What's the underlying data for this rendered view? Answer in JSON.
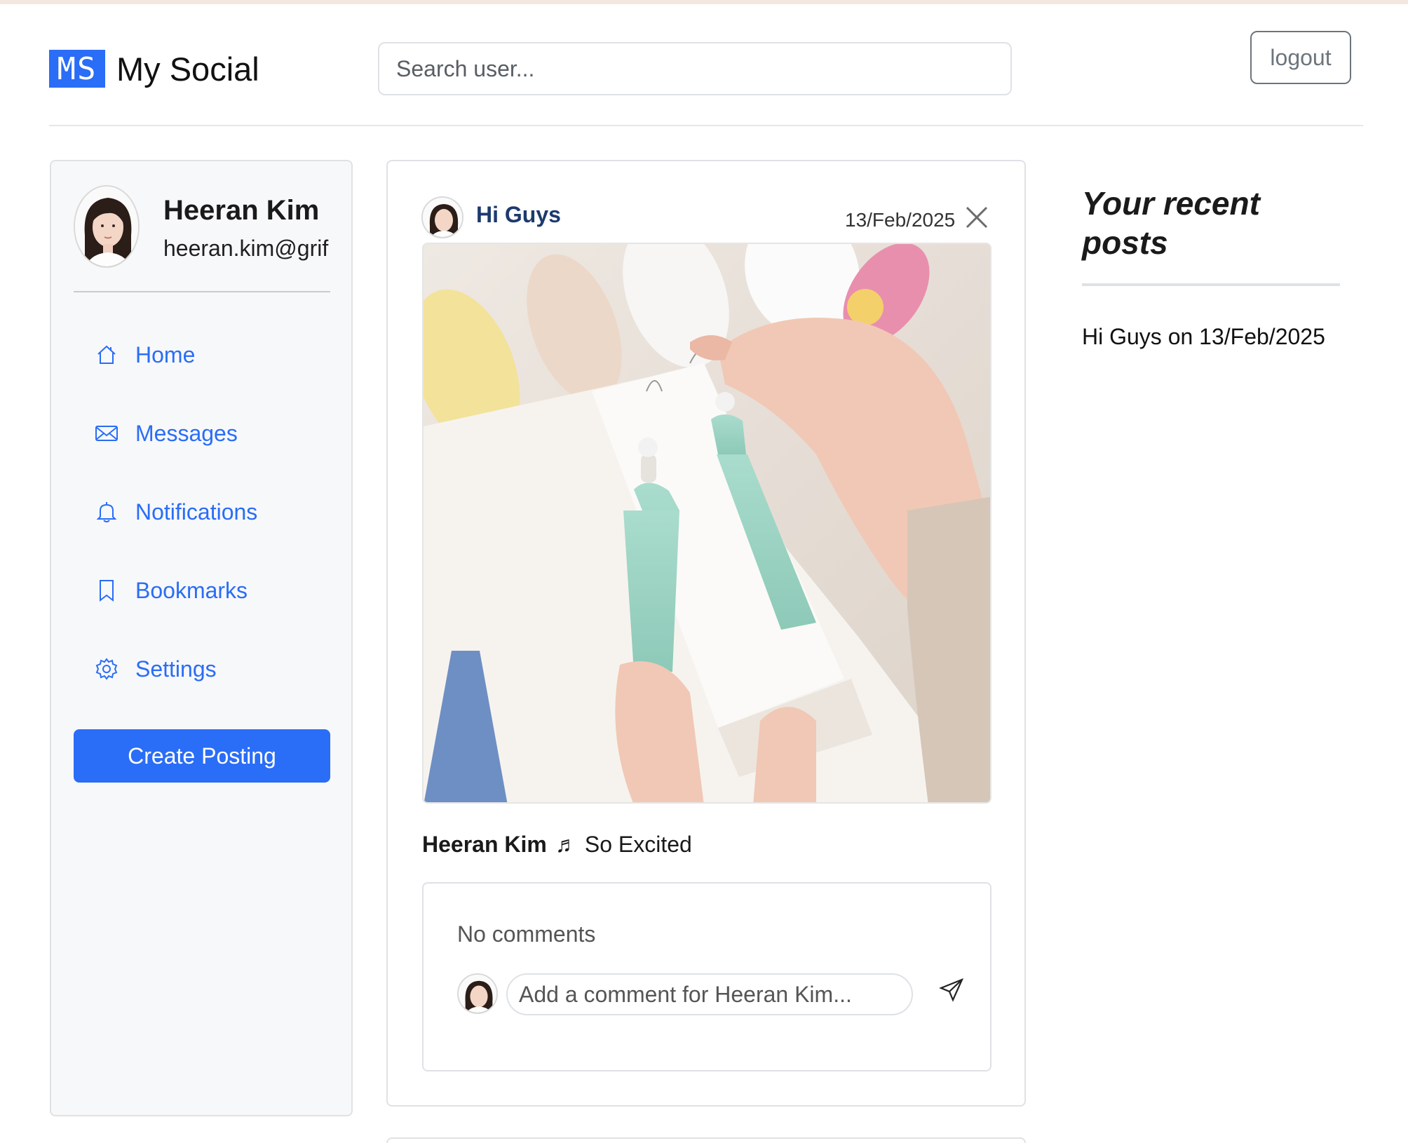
{
  "header": {
    "logo_text": "MS",
    "app_name": "My Social",
    "search_placeholder": "Search user...",
    "logout_label": "logout"
  },
  "profile": {
    "name": "Heeran Kim",
    "email": "heeran.kim@grif"
  },
  "nav": {
    "items": [
      {
        "label": "Home",
        "icon": "home-icon"
      },
      {
        "label": "Messages",
        "icon": "envelope-icon"
      },
      {
        "label": "Notifications",
        "icon": "bell-icon"
      },
      {
        "label": "Bookmarks",
        "icon": "bookmark-icon"
      },
      {
        "label": "Settings",
        "icon": "gear-icon"
      }
    ],
    "create_label": "Create Posting"
  },
  "post": {
    "title": "Hi Guys",
    "date": "13/Feb/2025",
    "author": "Heeran Kim",
    "music_icon": "music-note-icon",
    "caption": "So Excited",
    "no_comments": "No comments",
    "comment_placeholder": "Add a comment for Heeran Kim..."
  },
  "recent": {
    "title": "Your recent posts",
    "items": [
      "Hi Guys on 13/Feb/2025"
    ]
  },
  "colors": {
    "accent": "#2a6df6",
    "post_title": "#1c3a6e",
    "sidebar_bg": "#f7f8fa"
  }
}
